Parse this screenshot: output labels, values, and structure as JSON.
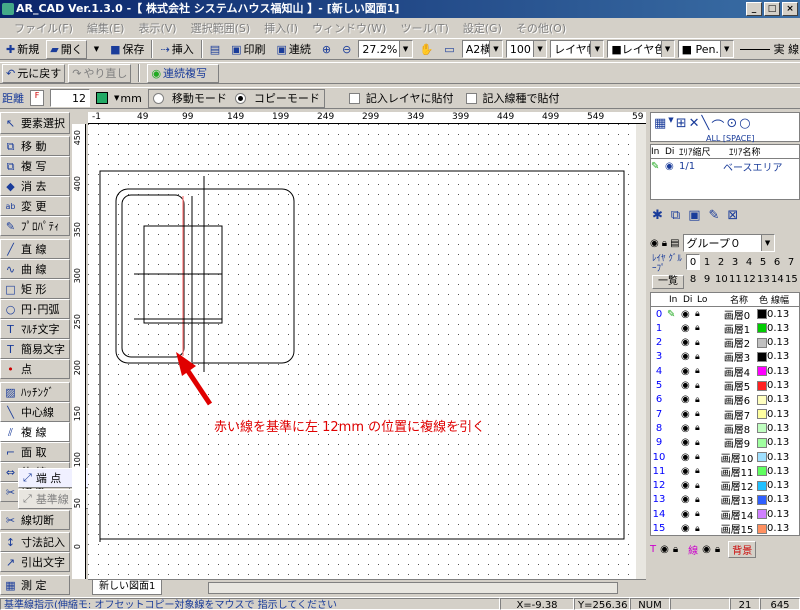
{
  "window": {
    "title": "AR_CAD Ver.1.3.0  -【 株式会社 システムハウス福知山 】- [新しい図面1]"
  },
  "menu": [
    "ファイル(F)",
    "編集(E)",
    "表示(V)",
    "選択範囲(S)",
    "挿入(I)",
    "ウィンドウ(W)",
    "ツール(T)",
    "設定(G)",
    "その他(O)"
  ],
  "toolbar1": {
    "new": "新規",
    "open": "開く",
    "save": "保存",
    "insert": "挿入",
    "print": "印刷",
    "continuous": "連続",
    "zoom": "27.2%",
    "paper": "A2横",
    "scale": "100",
    "layer_width": "レイヤ幅",
    "layer_color": "■レイヤ色",
    "pen": "■ Pen. 1",
    "line_type": "実 線"
  },
  "toolbar2": {
    "undo": "元に戻す",
    "redo": "やり直し",
    "command": "連続複写"
  },
  "toolbar3": {
    "distance_label": "距離",
    "distance_value": "12",
    "unit": "mm",
    "mode_move": "移動モード",
    "mode_copy": "コピーモード",
    "opt1": "記入レイヤに貼付",
    "opt2": "記入線種で貼付"
  },
  "tools": [
    "要素選択",
    "移 動",
    "複 写",
    "消 去",
    "変 更",
    "ﾌﾟﾛﾊﾟﾃｨ",
    "直 線",
    "曲 線",
    "矩 形",
    "円･円弧",
    "ﾏﾙﾁ文字",
    "簡易文字",
    "点",
    "ﾊｯﾁﾝｸﾞ",
    "中心線",
    "複 線",
    "面 取",
    "伸 縮",
    "切 断",
    "線切断",
    "寸法記入",
    "引出文字",
    "測 定"
  ],
  "submenu": {
    "item1": "端 点",
    "item2": "基準線"
  },
  "ruler_h": [
    "-1",
    "49",
    "99",
    "149",
    "199",
    "249",
    "299",
    "349",
    "399",
    "449",
    "499",
    "549",
    "59"
  ],
  "ruler_v": [
    "450",
    "400",
    "350",
    "300",
    "250",
    "200",
    "150",
    "100",
    "50",
    "0"
  ],
  "annotation": "赤い線を基準に左 12mm の位置に複線を引く",
  "tab": "新しい図面1",
  "right": {
    "all_label": "ALL [SPACE]",
    "area_headers": [
      "In",
      "Di",
      "ｴﾘｱ縮尺",
      "ｴﾘｱ名称"
    ],
    "area_row": {
      "scale": "1/1",
      "name": "ベースエリア"
    },
    "group_label": "グループ０",
    "layer_group_label": "ﾚｲﾔ ｸﾞﾙｰﾌﾟ",
    "group_nums": [
      "0",
      "1",
      "2",
      "3",
      "4",
      "5",
      "6",
      "7",
      "8",
      "9",
      "10",
      "11",
      "12",
      "13",
      "14",
      "15"
    ],
    "list_label": "一覧",
    "layer_headers": [
      "In",
      "Di",
      "Lo",
      "名称",
      "色",
      "線幅"
    ],
    "layers": [
      {
        "num": "0",
        "name": "画層0",
        "color": "#000000",
        "width": "0.13"
      },
      {
        "num": "1",
        "name": "画層1",
        "color": "#00cc00",
        "width": "0.13"
      },
      {
        "num": "2",
        "name": "画層2",
        "color": "#c0c0c0",
        "width": "0.13"
      },
      {
        "num": "3",
        "name": "画層3",
        "color": "#000000",
        "width": "0.13"
      },
      {
        "num": "4",
        "name": "画層4",
        "color": "#ff00ff",
        "width": "0.13"
      },
      {
        "num": "5",
        "name": "画層5",
        "color": "#ff2020",
        "width": "0.13"
      },
      {
        "num": "6",
        "name": "画層6",
        "color": "#ffffc0",
        "width": "0.13"
      },
      {
        "num": "7",
        "name": "画層7",
        "color": "#ffffa0",
        "width": "0.13"
      },
      {
        "num": "8",
        "name": "画層8",
        "color": "#c0ffc0",
        "width": "0.13"
      },
      {
        "num": "9",
        "name": "画層9",
        "color": "#a0ffa0",
        "width": "0.13"
      },
      {
        "num": "10",
        "name": "画層10",
        "color": "#a0e0ff",
        "width": "0.13"
      },
      {
        "num": "11",
        "name": "画層11",
        "color": "#60ff60",
        "width": "0.13"
      },
      {
        "num": "12",
        "name": "画層12",
        "color": "#20c0ff",
        "width": "0.13"
      },
      {
        "num": "13",
        "name": "画層13",
        "color": "#3060ff",
        "width": "0.13"
      },
      {
        "num": "14",
        "name": "画層14",
        "color": "#d080ff",
        "width": "0.13"
      },
      {
        "num": "15",
        "name": "画層15",
        "color": "#ff9060",
        "width": "0.13"
      }
    ],
    "bottom": {
      "t": "T",
      "line": "線",
      "bg": "背景"
    }
  },
  "status": {
    "prompt": "基準線指示(伸縮モ: オフセットコピー対象線をマウスで 指示してください",
    "x": "X=-9.38",
    "y": "Y=256.36",
    "num": "NUM",
    "n1": "21",
    "n2": "645"
  }
}
